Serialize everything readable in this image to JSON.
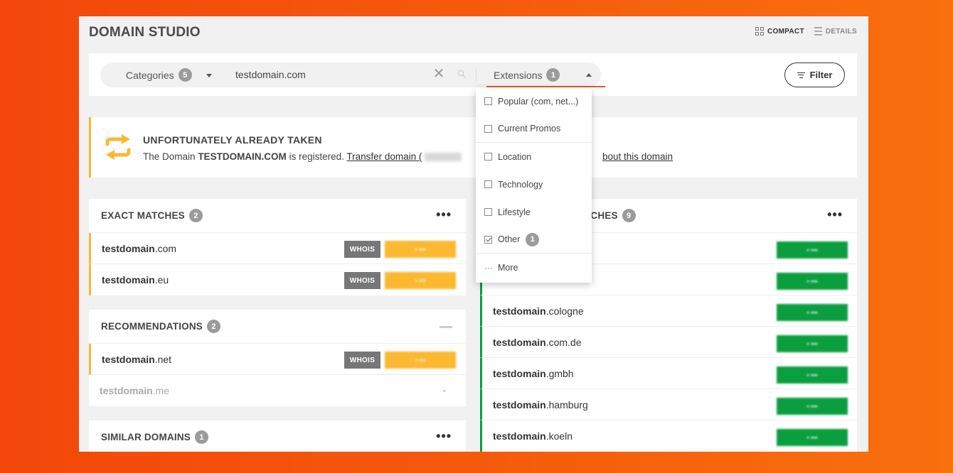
{
  "app": {
    "title": "DOMAIN STUDIO"
  },
  "views": [
    {
      "label": "COMPACT",
      "icon": "grid-icon",
      "active": true
    },
    {
      "label": "DETAILS",
      "icon": "list-icon",
      "active": false
    }
  ],
  "search": {
    "categories_label": "Categories",
    "categories_count": "5",
    "query": "testdomain.com",
    "extensions_label": "Extensions",
    "extensions_count": "1",
    "filter_label": "Filter"
  },
  "extensions_menu": {
    "items": [
      {
        "label": "Popular (com, net...)",
        "checked": false
      },
      {
        "label": "Current Promos",
        "checked": false
      },
      {
        "label": "Location",
        "checked": false
      },
      {
        "label": "Technology",
        "checked": false
      },
      {
        "label": "Lifestyle",
        "checked": false
      },
      {
        "label": "Other",
        "checked": true,
        "count": "1"
      }
    ],
    "more_label": "More"
  },
  "notice": {
    "title": "UNFORTUNATELY ALREADY TAKEN",
    "text_prefix": "The Domain",
    "domain": "TESTDOMAIN.COM",
    "text_suffix": "is registered.",
    "transfer_link": "Transfer domain (",
    "info_link": "bout this domain"
  },
  "exact_matches": {
    "title": "EXACT MATCHES",
    "count": "2",
    "rows": [
      {
        "name": "testdomain",
        "tld": ".com",
        "whois": "WHOIS"
      },
      {
        "name": "testdomain",
        "tld": ".eu",
        "whois": "WHOIS"
      }
    ]
  },
  "recommendations": {
    "title": "RECOMMENDATIONS",
    "count": "2",
    "rows": [
      {
        "name": "testdomain",
        "tld": ".net",
        "whois": "WHOIS"
      },
      {
        "name": "testdomain",
        "tld": ".me",
        "dash": "-"
      }
    ]
  },
  "similar": {
    "title": "SIMILAR DOMAINS",
    "count": "1"
  },
  "other_matches": {
    "title": "ATCHES",
    "count": "9",
    "rows": [
      {
        "name": "",
        "tld": ""
      },
      {
        "name": "",
        "tld": ""
      },
      {
        "name": "testdomain",
        "tld": ".cologne"
      },
      {
        "name": "testdomain",
        "tld": ".com.de"
      },
      {
        "name": "testdomain",
        "tld": ".gmbh"
      },
      {
        "name": "testdomain",
        "tld": ".hamburg"
      },
      {
        "name": "testdomain",
        "tld": ".koeln"
      }
    ]
  },
  "colors": {
    "accent": "#e0592a",
    "amber": "#fbb931",
    "green": "#0a9e3f",
    "badge": "#9b9b9b"
  }
}
